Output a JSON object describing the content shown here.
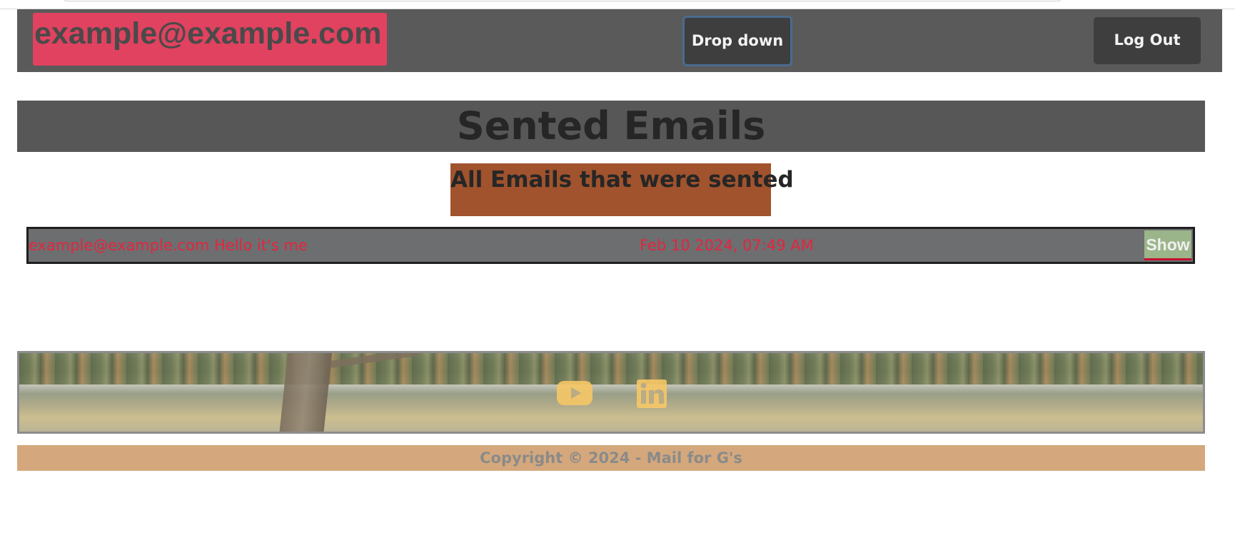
{
  "header": {
    "user_email": "example@example.com",
    "dropdown_label": "Drop down",
    "logout_label": "Log Out"
  },
  "main": {
    "title": "Sented Emails",
    "subtitle": "All Emails that were sented",
    "emails": [
      {
        "sender": "example@example.com",
        "subject": "Hello it's me",
        "date": "Feb 10 2024, 07:49 AM",
        "action_label": "Show"
      }
    ]
  },
  "footer": {
    "social_icons": [
      "youtube-icon",
      "linkedin-icon"
    ],
    "copyright": "Copyright © 2024 - Mail for G's"
  },
  "colors": {
    "topbar": "#5a5a5a",
    "email_badge": "#e0425f",
    "button_dark": "#3e3e3e",
    "heading_bg": "#575757",
    "subheading_bg": "#a0532d",
    "row_bg": "#6d6e70",
    "row_text": "#e3263f",
    "show_button": "#9bb58a",
    "social_icon": "#f6c766",
    "copyright_bg": "#d4a87c"
  }
}
